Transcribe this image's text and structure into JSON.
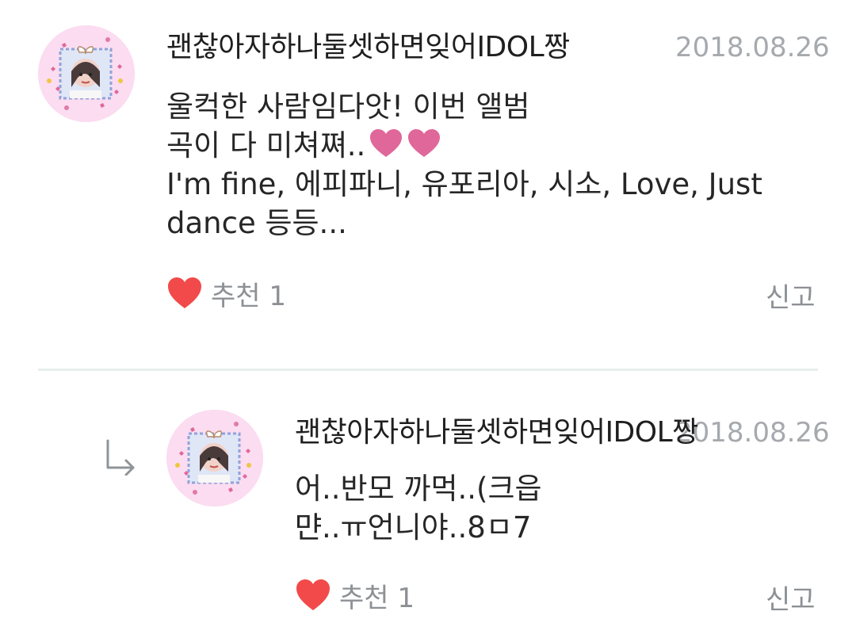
{
  "comments": [
    {
      "author": "괜찮아자하나둘셋하면잊어IDOL짱",
      "date": "2018.08.26",
      "lines": [
        "울컥한 사람임다앗! 이번 앨범",
        "곡이 다 미쳐쪄..",
        "I'm fine, 에피파니, 유포리아, 시소, Love, Just",
        "dance 등등..."
      ],
      "like_label": "추천 1",
      "report_label": "신고"
    }
  ],
  "reply": {
    "author": "괜찮아자하나둘셋하면잊어IDOL짱",
    "date": "2018.08.26",
    "lines": [
      "어..반모 까먹..(크읍",
      "먄..ㅠ언니야..8ㅁ7"
    ],
    "like_label": "추천 1",
    "report_label": "신고"
  },
  "icons": {
    "like": "heart-icon",
    "reply": "reply-arrow-icon",
    "emoji": "pink-heart-emoji"
  },
  "colors": {
    "like_heart": "#f24a4a",
    "emoji_heart": "#e0679a",
    "avatar_bg": "#fbdcf1",
    "divider": "#e7efec",
    "meta_text": "#8d9094"
  }
}
